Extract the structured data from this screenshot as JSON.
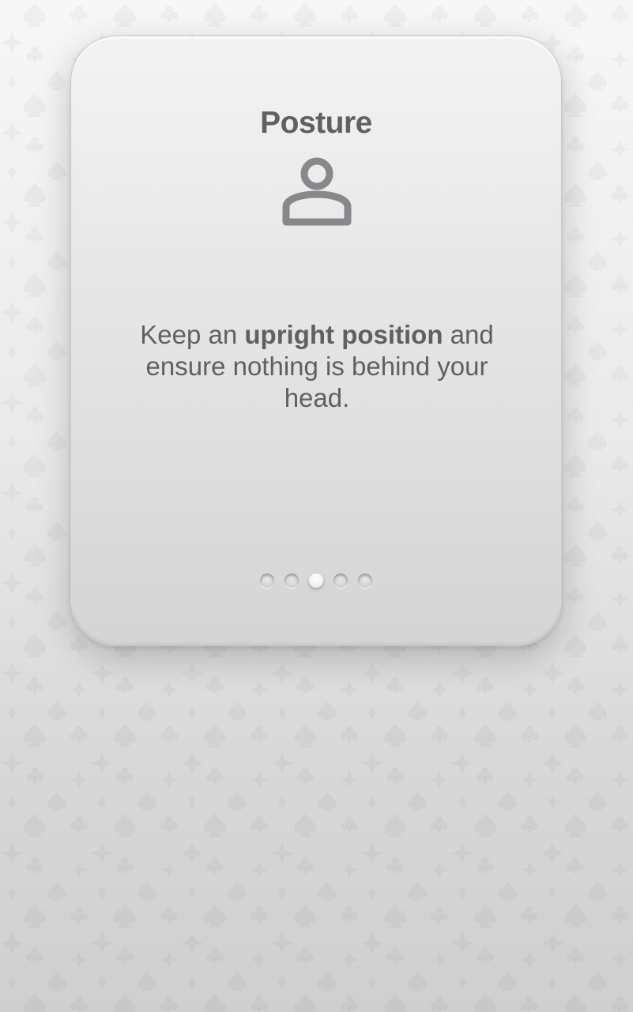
{
  "card": {
    "title": "Posture",
    "icon": "person-icon",
    "message_before": "Keep an ",
    "message_bold": "upright position",
    "message_after": " and ensure nothing is behind your head."
  },
  "pagination": {
    "total": 5,
    "active_index": 2
  },
  "colors": {
    "text": "#5e6063",
    "icon": "#87888b",
    "background": "#e6e6e6"
  }
}
